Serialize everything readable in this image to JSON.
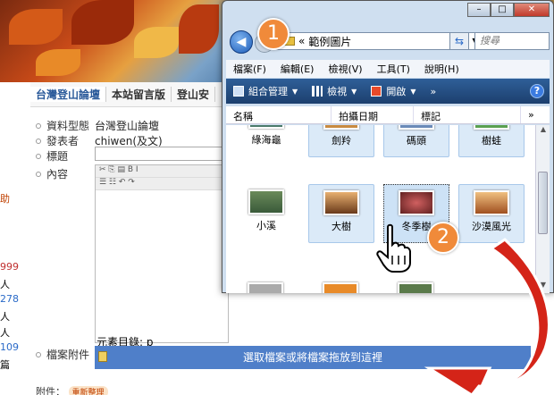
{
  "forum": {
    "tabs": [
      "台灣登山論壇",
      "本站留言版",
      "登山安"
    ],
    "side_numbers": [
      "999",
      "人",
      "278",
      "人",
      "人",
      "109",
      "篇"
    ],
    "side_labels": [
      "助"
    ],
    "rows": {
      "type_label": "資料型態",
      "type_value": "台灣登山論壇",
      "poster_label": "發表者",
      "poster_value": "chiwen(及文)",
      "title_label": "標題",
      "content_label": "內容",
      "attach_label": "檔案附件"
    },
    "element_path": "元素目錄: p",
    "drop_text": "選取檔案或將檔案拖放到這裡",
    "attach_footer": "附件：",
    "attach_badge": "重新整理"
  },
  "explorer": {
    "window_buttons": [
      "–",
      "□",
      "✕"
    ],
    "address_prefix": "«",
    "address_path": "範例圖片",
    "search_placeholder": "搜尋",
    "menu": [
      "檔案(F)",
      "編輯(E)",
      "檢視(V)",
      "工具(T)",
      "說明(H)"
    ],
    "commands": {
      "organize": "組合管理",
      "views": "檢視",
      "open": "開啟",
      "more": "»",
      "help": "?"
    },
    "columns": [
      "名稱",
      "拍攝日期",
      "標記",
      "»"
    ],
    "files_top": [
      "綠海龜",
      "劍羚",
      "碼頭",
      "樹蛙"
    ],
    "files_bottom": [
      "小溪",
      "大樹",
      "冬季樹",
      "沙漠風光"
    ]
  },
  "callouts": {
    "one": "1",
    "two": "2"
  },
  "colors": {
    "accent": "#f08a3a",
    "drop_bar": "#4f7fc9",
    "cmdbar": "#2f5f98",
    "arrow": "#d42418"
  }
}
